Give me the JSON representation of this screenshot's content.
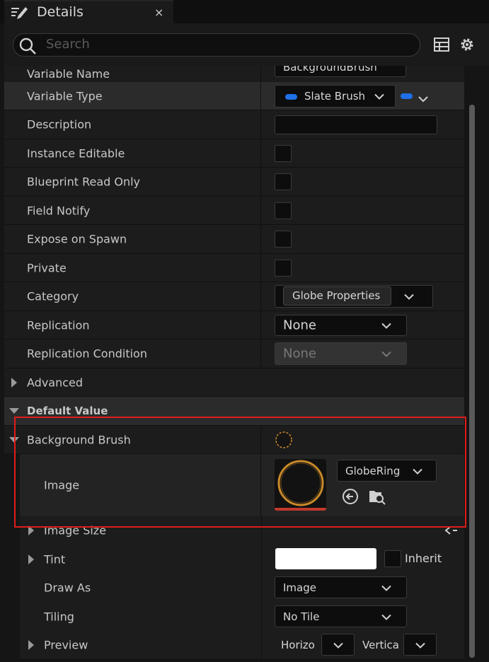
{
  "tab": {
    "title": "Details",
    "close_label": "×"
  },
  "search": {
    "placeholder": "Search"
  },
  "rows": {
    "variable_name": {
      "label": "Variable Name",
      "value": "BackgroundBrush"
    },
    "variable_type": {
      "label": "Variable Type",
      "value": "Slate Brush",
      "pin_color": "#1f6fe8"
    },
    "description": {
      "label": "Description",
      "value": ""
    },
    "instance_editable": {
      "label": "Instance Editable",
      "checked": false
    },
    "blueprint_read_only": {
      "label": "Blueprint Read Only",
      "checked": false
    },
    "field_notify": {
      "label": "Field Notify",
      "checked": false
    },
    "expose_on_spawn": {
      "label": "Expose on Spawn",
      "checked": false
    },
    "private": {
      "label": "Private",
      "checked": false
    },
    "category": {
      "label": "Category",
      "value": "Globe Properties"
    },
    "replication": {
      "label": "Replication",
      "value": "None"
    },
    "replication_condition": {
      "label": "Replication Condition",
      "value": "None"
    },
    "advanced": {
      "label": "Advanced"
    }
  },
  "default_value": {
    "header": "Default Value",
    "background_brush": {
      "label": "Background Brush"
    },
    "image": {
      "label": "Image",
      "asset": "GlobeRing"
    },
    "image_size": {
      "label": "Image Size"
    },
    "tint": {
      "label": "Tint",
      "inherit_label": "Inherit",
      "color": "#ffffff"
    },
    "draw_as": {
      "label": "Draw As",
      "value": "Image"
    },
    "tiling": {
      "label": "Tiling",
      "value": "No Tile"
    },
    "preview": {
      "label": "Preview",
      "horizontal_label": "Horizo",
      "vertical_label": "Vertica"
    }
  },
  "colors": {
    "highlight_box": "#e01b1b",
    "accent_blue": "#1f6fe8",
    "ring_gold": "#c98a2a"
  }
}
